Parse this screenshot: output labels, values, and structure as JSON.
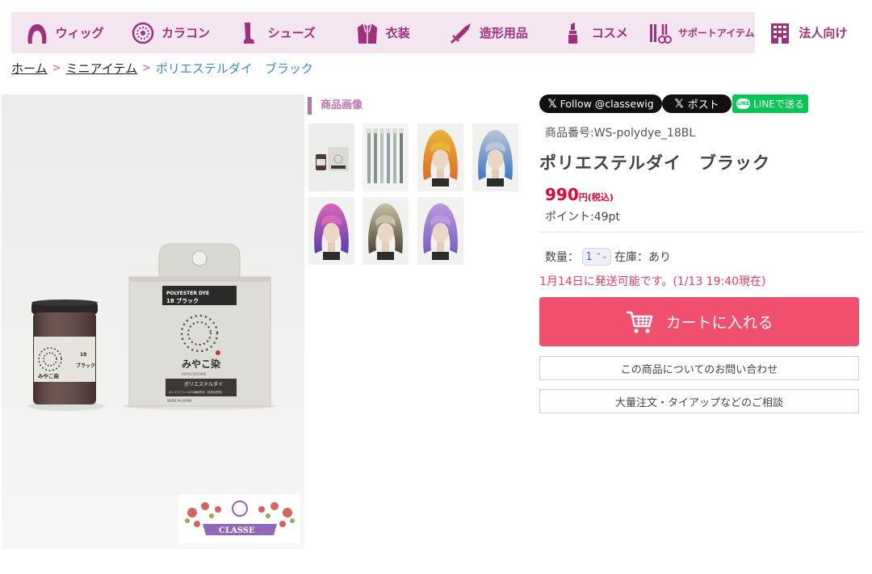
{
  "nav": {
    "items": [
      {
        "label": "ウィッグ",
        "icon": "wig-icon"
      },
      {
        "label": "カラコン",
        "icon": "contact-lens-icon"
      },
      {
        "label": "シューズ",
        "icon": "boot-icon"
      },
      {
        "label": "衣装",
        "icon": "costume-icon"
      },
      {
        "label": "造形用品",
        "icon": "sword-icon"
      },
      {
        "label": "コスメ",
        "icon": "lipstick-icon"
      },
      {
        "label": "サポートアイテム",
        "icon": "support-tools-icon"
      },
      {
        "label": "法人向け",
        "icon": "building-icon"
      }
    ],
    "active_index": 7
  },
  "breadcrumb": {
    "home": "ホーム",
    "category": "ミニアイテム",
    "current": "ポリエステルダイ　ブラック",
    "separator": ">"
  },
  "main_image": {
    "jar_label_num": "18",
    "jar_label_text": "ブラック",
    "jar_brand": "みやこ染",
    "box_line1": "POLYESTER DYE",
    "box_line2": "18 ブラック",
    "box_brand": "みやこ染",
    "box_brand_sub": "MIYACOZOME",
    "box_band1": "ポリエステルダイ",
    "box_band2": "ポリエステル 100%繊維専用（前熱処理用）",
    "box_made": "MADE IN JAPAN",
    "watermark": "CLASSE"
  },
  "gallery": {
    "title": "商品画像",
    "thumbs": [
      {
        "name": "thumb-product",
        "kind": "product"
      },
      {
        "name": "thumb-swatches",
        "kind": "swatch"
      },
      {
        "name": "thumb-yellow-wig",
        "kind": "wig",
        "hair": "#e9b33a",
        "tip": "#e06a22"
      },
      {
        "name": "thumb-silver-wig",
        "kind": "wig",
        "hair": "#b8c6d8",
        "tip": "#3d74c8"
      },
      {
        "name": "thumb-pink-wig",
        "kind": "wig",
        "hair": "#d867b8",
        "tip": "#5a3cb0"
      },
      {
        "name": "thumb-ash-wig",
        "kind": "wig",
        "hair": "#c8c0a4",
        "tip": "#4a4436"
      },
      {
        "name": "thumb-lavender-wig",
        "kind": "wig",
        "hair": "#b99adc",
        "tip": "#7a5ec4"
      }
    ]
  },
  "share": {
    "x_follow": "Follow @classewig",
    "x_post": "ポスト",
    "line": "LINEで送る",
    "line_badge": "LINE",
    "x_glyph": "𝕏"
  },
  "product": {
    "sku": "商品番号:WS-polydye_18BL",
    "title": "ポリエステルダイ　ブラック",
    "price": "990",
    "price_unit": "円(税込)",
    "points": "ポイント:49pt",
    "qty_label": "数量：",
    "qty_value": "1",
    "qty_arrows": "⌃⌄",
    "stock": "在庫：あり",
    "ship_note": "1月14日に発送可能です。(1/13 19:40現在)",
    "cart_label": "カートに入れる",
    "inquiry_label": "この商品についてのお問い合わせ",
    "bulk_label": "大量注文・タイアップなどのご相談"
  },
  "colors": {
    "nav_bg": "#f4e6f1",
    "nav_text": "#a0307c",
    "cart": "#f0506e",
    "price": "#e60033",
    "ship_note": "#e83a62",
    "line": "#06c755"
  }
}
